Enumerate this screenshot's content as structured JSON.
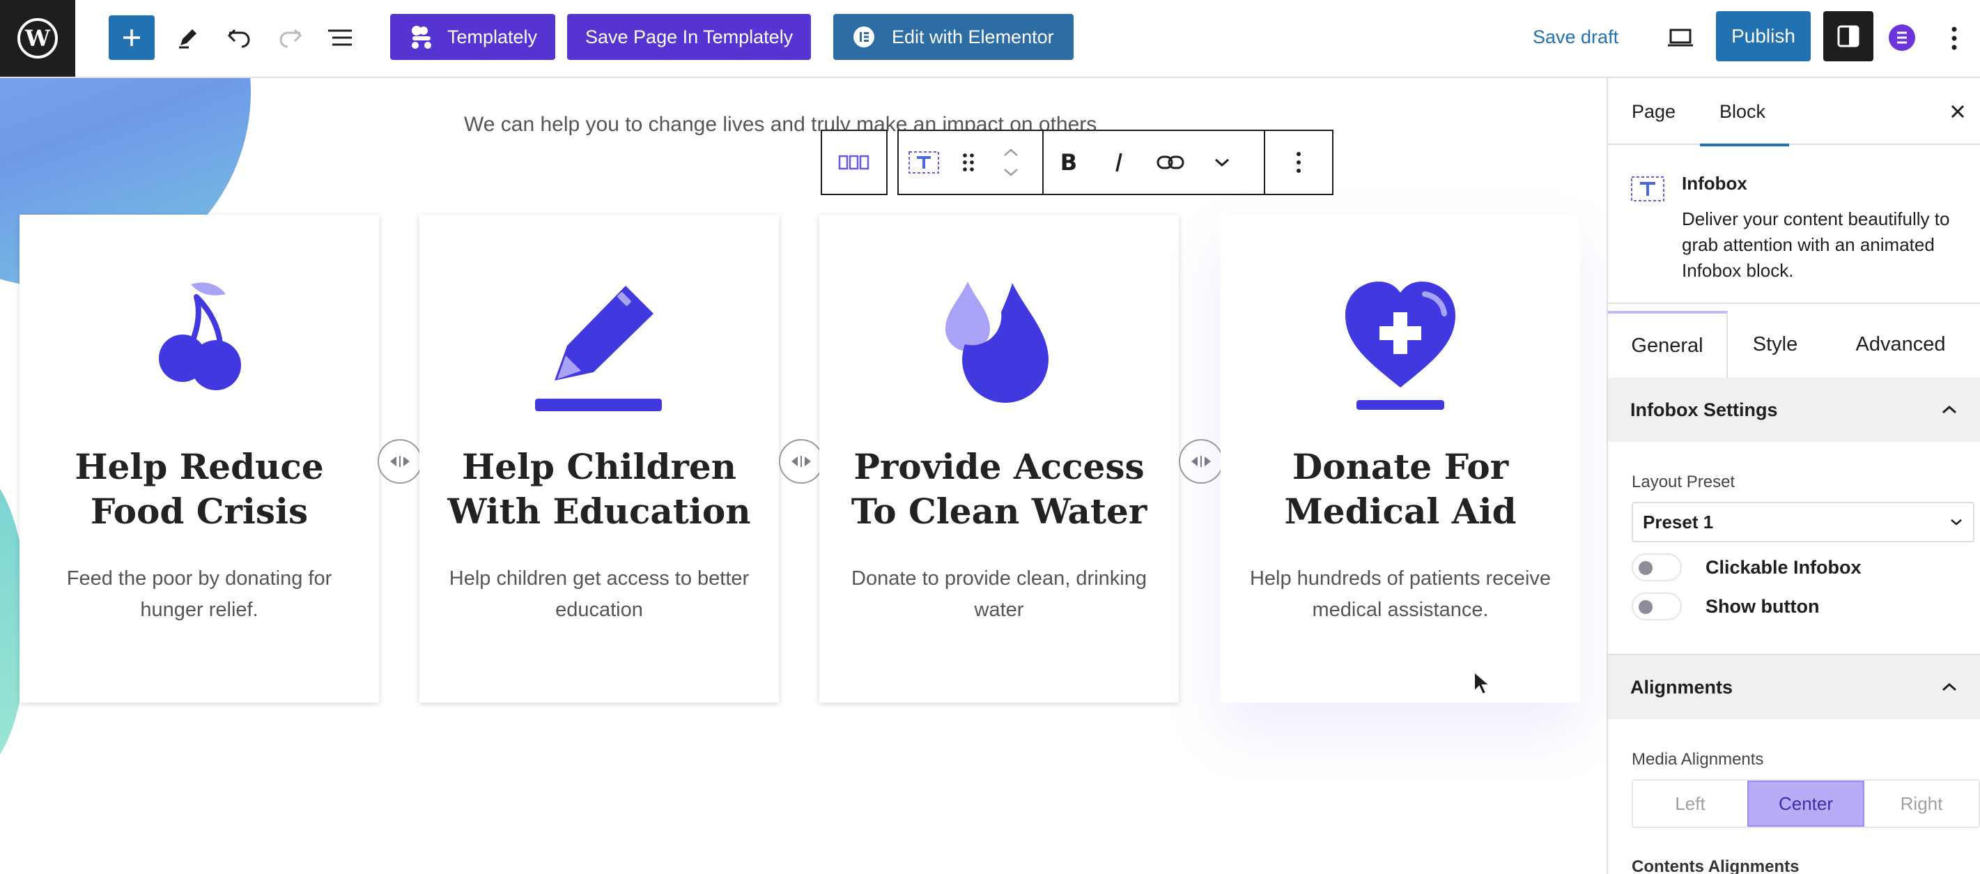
{
  "colors": {
    "wp_blue": "#2271b1",
    "templately_purple": "#5634d1",
    "elementor_blue": "#2e6da4",
    "icon_blue": "#4138e0",
    "icon_light": "#a9a3f7"
  },
  "toolbar": {
    "templately_label": "Templately",
    "save_templately_label": "Save Page In Templately",
    "elementor_label": "Edit with Elementor",
    "save_draft_label": "Save draft",
    "publish_label": "Publish",
    "icons": [
      "wordpress-logo-icon",
      "plus-icon",
      "pencil-icon",
      "undo-icon",
      "redo-icon",
      "list-view-icon",
      "desktop-preview-icon",
      "settings-panel-icon",
      "elementor-icon",
      "more-options-icon"
    ]
  },
  "canvas": {
    "subtitle": "We can help you to change lives and truly make an impact on others",
    "cards": [
      {
        "title": "Help Reduce Food Crisis",
        "description": "Feed the poor by donating for hunger relief.",
        "icon": "fruit-icon"
      },
      {
        "title": "Help Children With Education",
        "description": "Help children get access to better education",
        "icon": "pencil-write-icon"
      },
      {
        "title": "Provide Access To Clean Water",
        "description": "Donate to provide clean, drinking water",
        "icon": "water-drop-icon"
      },
      {
        "title": "Donate For Medical Aid",
        "description": "Help hundreds of patients receive medical assistance.",
        "icon": "heart-medical-icon"
      }
    ]
  },
  "sidebar": {
    "tabs": [
      "Page",
      "Block"
    ],
    "active_tab": "Block",
    "block": {
      "name": "Infobox",
      "description": "Deliver your content beautifully to grab attention with an animated Infobox block."
    },
    "settings_tabs": [
      "General",
      "Style",
      "Advanced"
    ],
    "active_settings_tab": "General",
    "infobox_settings": {
      "title": "Infobox Settings",
      "layout_preset_label": "Layout Preset",
      "layout_preset_value": "Preset 1",
      "clickable_label": "Clickable Infobox",
      "show_button_label": "Show button"
    },
    "alignments": {
      "title": "Alignments",
      "media_label": "Media Alignments",
      "options": [
        "Left",
        "Center",
        "Right"
      ],
      "selected": "Center",
      "contents_label": "Contents Alignments"
    }
  }
}
